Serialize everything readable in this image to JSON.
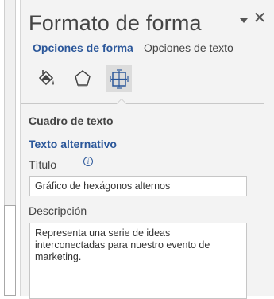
{
  "pane": {
    "title": "Formato de forma",
    "close_glyph": "✕",
    "tabs": [
      {
        "label": "Opciones de forma",
        "active": true
      },
      {
        "label": "Opciones de texto",
        "active": false
      }
    ],
    "icons": [
      {
        "name": "fill-line-icon",
        "selected": false
      },
      {
        "name": "effects-pentagon-icon",
        "selected": false
      },
      {
        "name": "size-properties-icon",
        "selected": true
      }
    ]
  },
  "section": {
    "heading": "Cuadro de texto",
    "alt_text": {
      "heading": "Texto alternativo",
      "title_label": "Título",
      "info_glyph": "i",
      "title_value": "Gráfico de hexágonos alternos",
      "description_label": "Descripción",
      "description_value": "Representa una serie de ideas interconectadas para nuestro evento de marketing."
    }
  },
  "colors": {
    "accent": "#2b579a",
    "text": "#444444",
    "pane_background": "#f3f3f3"
  }
}
